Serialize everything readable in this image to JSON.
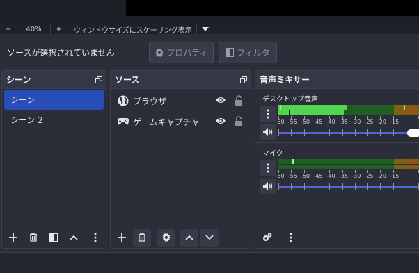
{
  "zoom_bar": {
    "minus_label": "−",
    "zoom_value": "40%",
    "plus_label": "+",
    "scale_label": "ウィンドウサイズにスケーリング表示",
    "dropdown_icon": "chevron-down-icon"
  },
  "source_toolbar": {
    "no_source_text": "ソースが選択されていません",
    "properties_label": "プロパティ",
    "filters_label": "フィルタ"
  },
  "scenes": {
    "title": "シーン",
    "items": [
      {
        "label": "シーン",
        "selected": true
      },
      {
        "label": "シーン 2",
        "selected": false
      }
    ]
  },
  "sources": {
    "title": "ソース",
    "items": [
      {
        "label": "ブラウザ",
        "icon": "globe-icon"
      },
      {
        "label": "ゲームキャプチャ",
        "icon": "gamepad-icon"
      }
    ]
  },
  "mixer": {
    "title": "音声ミキサー",
    "channels": [
      {
        "name": "デスクトップ音声",
        "level_fraction": 0.47,
        "peak_fraction": 0.14,
        "volume_fraction": 0.88
      },
      {
        "name": "マイク",
        "level_fraction": 0.0,
        "peak_fraction": 0.1,
        "volume_fraction": 1.0
      }
    ],
    "tick_labels": [
      "-60",
      "-55",
      "-50",
      "-45",
      "-40",
      "-35",
      "-30",
      "-25",
      "-20",
      "-15"
    ]
  },
  "colors": {
    "selected_scene": "#284cb8",
    "meter_green": "#53d450",
    "slider_blue": "#4a66d6"
  }
}
